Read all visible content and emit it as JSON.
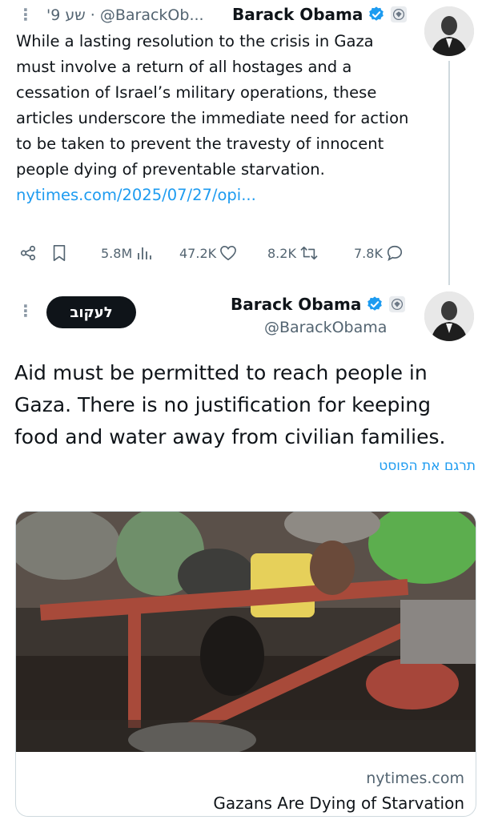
{
  "tweet1": {
    "author_name": "Barack Obama",
    "handle_time": "'שע 9 · @BarackOb...",
    "text": "While a lasting resolution to the crisis in Gaza must involve a return of all hostages and a cessation of Israel’s military operations, these articles underscore the immediate need for action to be taken to prevent the travesty of innocent people dying of preventable starvation. ",
    "link_text": "nytimes.com/2025/07/27/opi...",
    "stats": {
      "views": "5.8M",
      "likes": "47.2K",
      "retweets": "8.2K",
      "replies": "7.8K"
    }
  },
  "tweet2": {
    "author_name": "Barack Obama",
    "handle": "@BarackObama",
    "follow_label": "לעקוב",
    "text": "Aid must be permitted to reach people in Gaza. There is no justification for keeping food and water away from civilian families.",
    "translate_label": "תרגם את הפוסט",
    "card": {
      "domain": "nytimes.com",
      "title": "Gazans Are Dying of Starvation"
    }
  },
  "colors": {
    "link": "#1d9bf0",
    "verified": "#1d9bf0",
    "muted": "#536471",
    "follow_bg": "#0f1419"
  },
  "icons": [
    "more-icon",
    "verified-badge-icon",
    "gov-seal-icon",
    "share-icon",
    "bookmark-icon",
    "views-icon",
    "like-icon",
    "retweet-icon",
    "reply-icon"
  ]
}
